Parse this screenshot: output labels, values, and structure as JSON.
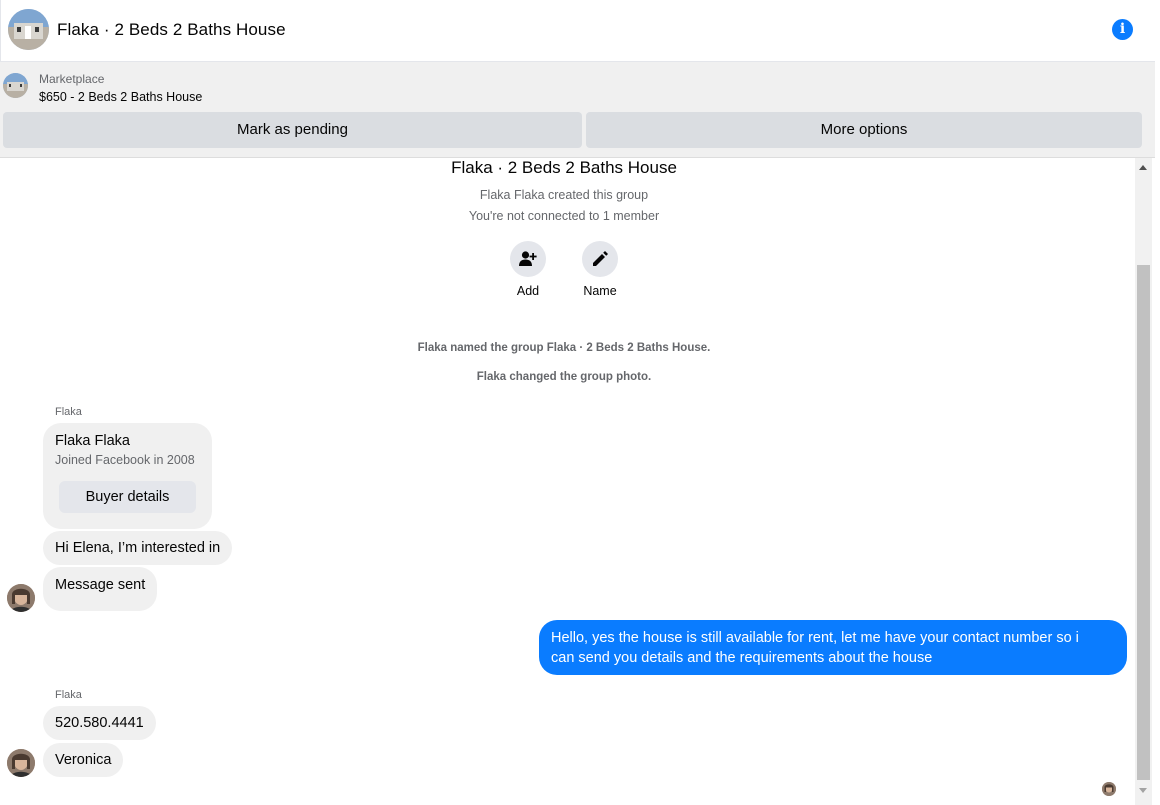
{
  "header": {
    "title": "Flaka · 2 Beds 2 Baths House",
    "info_icon": "info-icon",
    "accent": "#0a7cff"
  },
  "marketplace": {
    "label": "Marketplace",
    "listing": "$650 - 2 Beds 2 Baths House",
    "mark_pending": "Mark as pending",
    "more_options": "More options"
  },
  "group_info": {
    "title": "Flaka · 2 Beds 2 Baths House",
    "created_by": "Flaka Flaka created this group",
    "connection": "You're not connected to 1 member",
    "add_label": "Add",
    "name_label": "Name"
  },
  "system_messages": [
    "Flaka named the group Flaka · 2 Beds 2 Baths House.",
    "Flaka changed the group photo."
  ],
  "messages": {
    "sender_1": "Flaka",
    "profile_card": {
      "name": "Flaka Flaka",
      "joined": "Joined Facebook in 2008",
      "button": "Buyer details"
    },
    "in_1": "Hi Elena, I’m interested in",
    "in_2": "Message sent",
    "out_1_line1": "Hello, yes the house is still available for rent, let me have your contact number so i",
    "out_1_line2": "can send you details and the requirements about the house",
    "sender_2": "Flaka",
    "in_3": "520.580.4441",
    "in_4": "Veronica"
  }
}
